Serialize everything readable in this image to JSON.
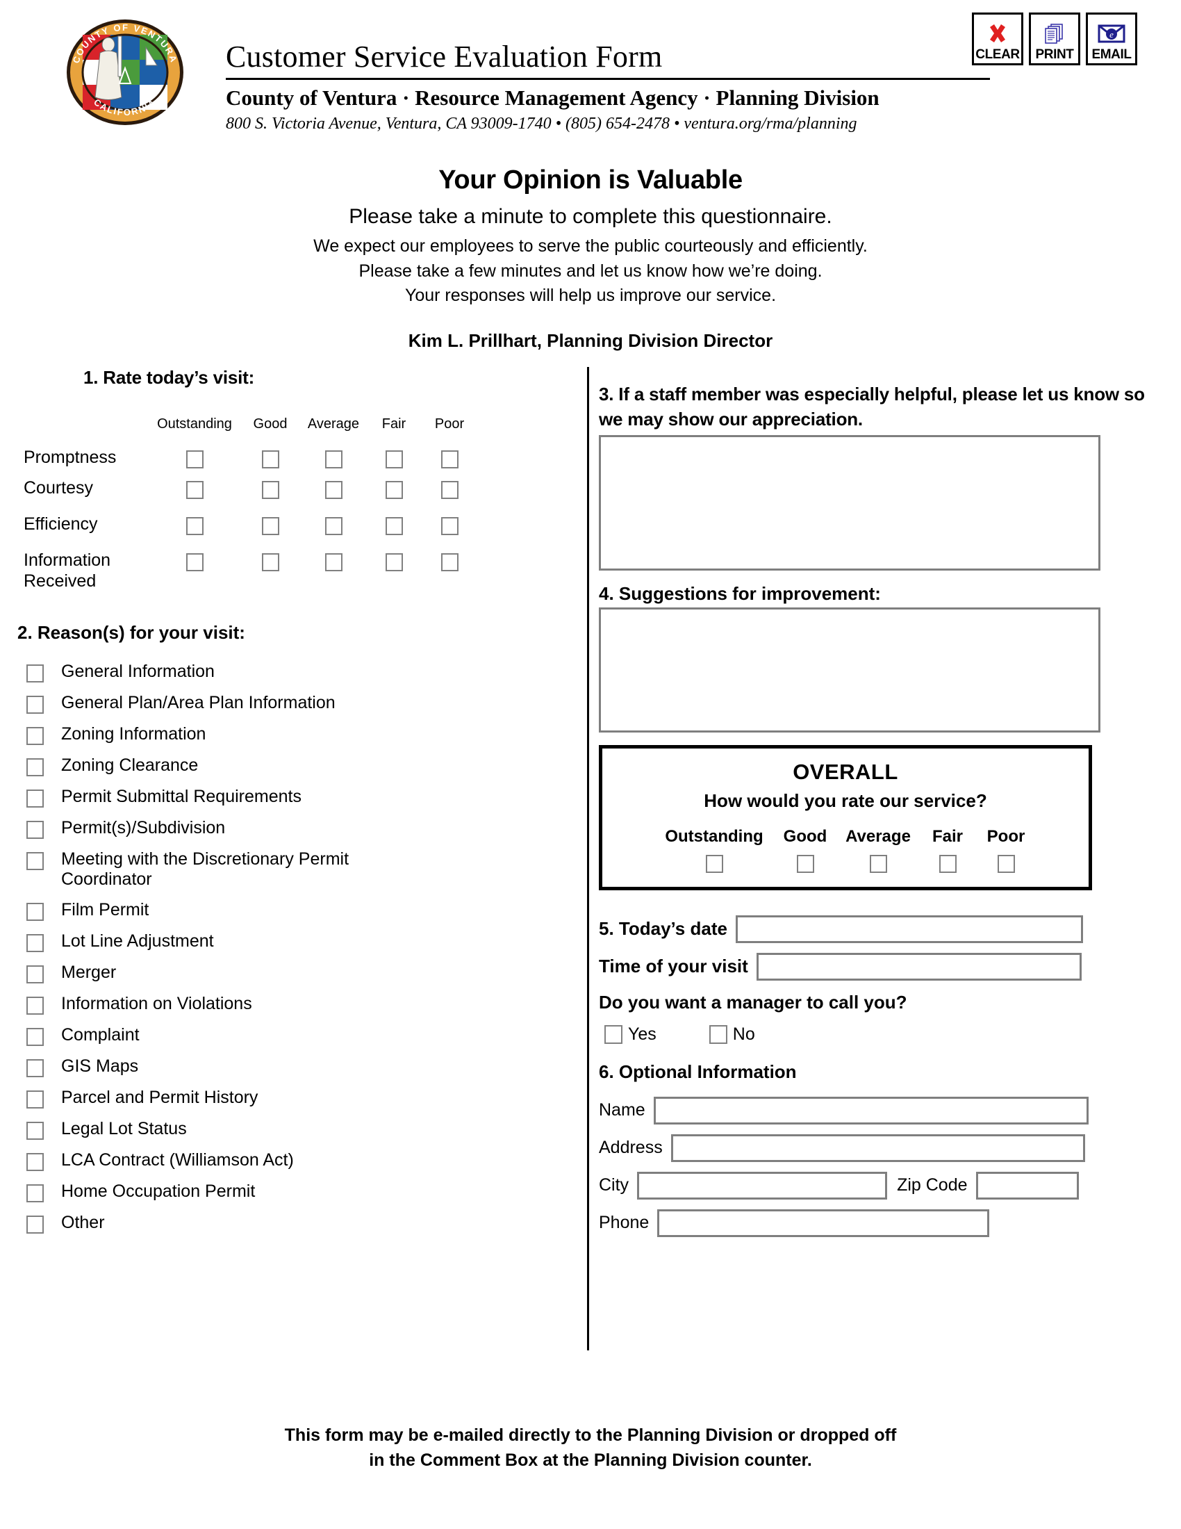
{
  "header": {
    "title": "Customer Service Evaluation Form",
    "agency": "County of Ventura · Resource Management Agency · Planning Division",
    "address": "800 S. Victoria Avenue, Ventura, CA 93009-1740 • (805) 654-2478 • ventura.org/rma/planning",
    "seal": {
      "outer_text_top": "COUNTY OF VENTURA",
      "outer_text_bottom": "CALIFORNIA",
      "ring_color": "#E8A33D",
      "red": "#D8232A",
      "blue": "#1D5FA8",
      "green": "#4A9B3C"
    },
    "buttons": [
      {
        "label": "CLEAR",
        "icon": "x-mark-icon",
        "color": "#E02020"
      },
      {
        "label": "PRINT",
        "icon": "printer-pages-icon",
        "color": "#3A35AA"
      },
      {
        "label": "EMAIL",
        "icon": "envelope-e-icon",
        "color": "#1F1F8C"
      }
    ]
  },
  "intro": {
    "heading": "Your Opinion is Valuable",
    "line1": "Please take a minute to complete this questionnaire.",
    "line2": "We expect our employees to serve the public courteously and efficiently.",
    "line3": "Please take a few minutes and let us know how we’re doing.",
    "line4": "Your responses will help us improve our service.",
    "director": "Kim L. Prillhart, Planning Division Director"
  },
  "q1": {
    "heading": "1.  Rate today’s visit:",
    "scale": [
      "Outstanding",
      "Good",
      "Average",
      "Fair",
      "Poor"
    ],
    "rows": [
      "Promptness",
      "Courtesy",
      "Efficiency",
      "Information Received"
    ]
  },
  "q2": {
    "heading": "2. Reason(s) for your visit:",
    "options": [
      "General Information",
      "General Plan/Area Plan Information",
      "Zoning Information",
      "Zoning Clearance",
      "Permit Submittal Requirements",
      "Permit(s)/Subdivision",
      "Meeting with the Discretionary Permit Coordinator",
      "Film Permit",
      "Lot Line Adjustment",
      "Merger",
      "Information on Violations",
      "Complaint",
      "GIS Maps",
      "Parcel and Permit History",
      "Legal Lot Status",
      "LCA Contract (Williamson Act)",
      "Home Occupation Permit",
      "Other"
    ]
  },
  "q3": {
    "heading": "3.  If a staff member was especially helpful, please let us know so we may show our appreciation.",
    "value": ""
  },
  "q4": {
    "heading": "4. Suggestions for improvement:",
    "value": ""
  },
  "overall": {
    "title": "OVERALL",
    "subtitle": "How would you rate our service?",
    "scale": [
      "Outstanding",
      "Good",
      "Average",
      "Fair",
      "Poor"
    ]
  },
  "q5": {
    "date_label": "5. Today’s date",
    "date_value": "",
    "time_label": "Time of your visit",
    "time_value": "",
    "manager_question": "Do you want a manager to call you?",
    "yes_label": "Yes",
    "no_label": "No"
  },
  "q6": {
    "heading": "6. Optional Information",
    "name_label": "Name",
    "name_value": "",
    "address_label": "Address",
    "address_value": "",
    "city_label": "City",
    "city_value": "",
    "zip_label": "Zip Code",
    "zip_value": "",
    "phone_label": "Phone",
    "phone_value": ""
  },
  "footer": {
    "line1": "This form may be e-mailed directly to the Planning Division or dropped off",
    "line2": "in the Comment Box at the Planning Division counter."
  }
}
